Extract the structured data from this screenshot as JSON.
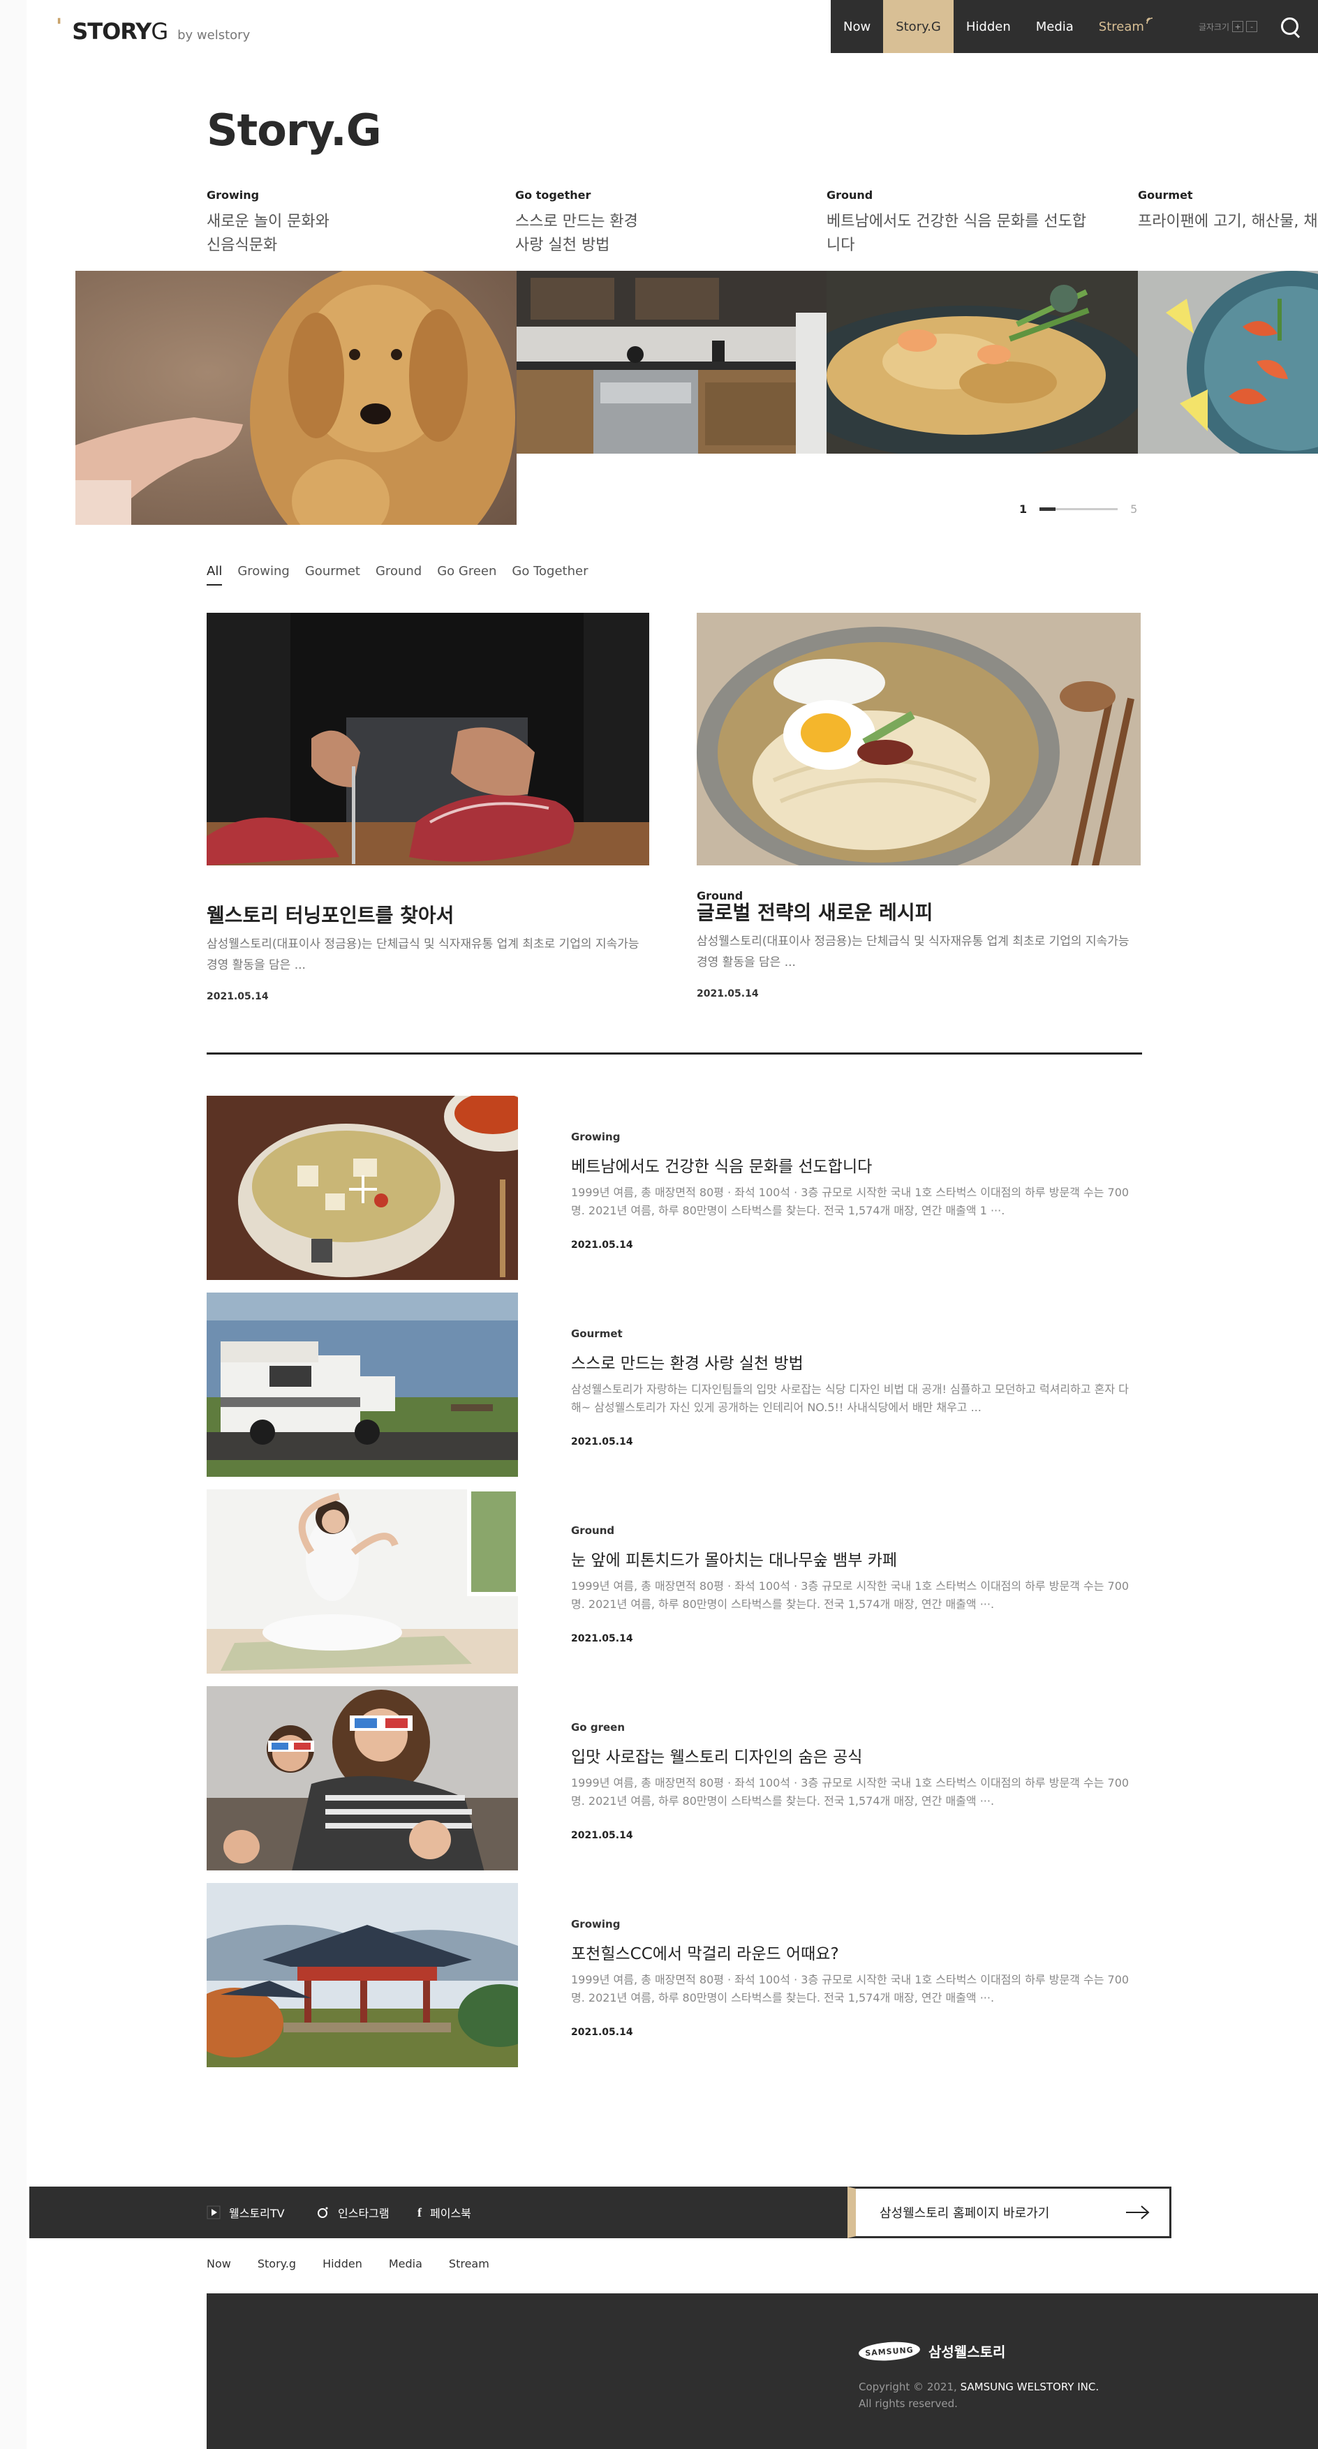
{
  "header": {
    "logo_mark": "'",
    "logo_story": "STORY",
    "logo_g": "G",
    "logo_by": "by welstory",
    "nav": [
      "Now",
      "Story.G",
      "Hidden",
      "Media",
      "Stream"
    ],
    "active_nav": "Story.G",
    "font_size_label": "글자크기",
    "font_plus": "+",
    "font_minus": "-"
  },
  "page_title": "Story.G",
  "carousel": {
    "slides": [
      {
        "category": "Growing",
        "title_line1": "새로운 놀이 문화와",
        "title_line2": "신음식문화",
        "image": "golden retriever giving paw"
      },
      {
        "category": "Go together",
        "title_line1": "스스로 만드는 환경",
        "title_line2": "사랑 실천 방법",
        "image": "modern kitchen"
      },
      {
        "category": "Ground",
        "title_line1": "베트남에서도 건강한 식음 문화를 선도합",
        "title_line2": "니다",
        "image": "pad thai plate"
      },
      {
        "category": "Gourmet",
        "title_line1": "프라이팬에 고기, 해산물, 채",
        "title_line2": "",
        "image": "shrimp seafood dish"
      }
    ],
    "pager_current": "1",
    "pager_total": "5",
    "pager_progress": 0.2
  },
  "filters": [
    "All",
    "Growing",
    "Gourmet",
    "Ground",
    "Go Green",
    "Go Together"
  ],
  "active_filter": "All",
  "featured": [
    {
      "category": "",
      "title": "웰스토리 터닝포인트를 찾아서",
      "desc": "삼성웰스토리(대표이사 정금용)는 단체급식 및 식자재유통 업계 최초로 기업의 지속가능경영 활동을 담은 ...",
      "date": "2021.05.14",
      "image": "chef cutting meat"
    },
    {
      "category": "Ground",
      "title": "글로벌 전략의 새로운 레시피",
      "desc": "삼성웰스토리(대표이사 정금용)는 단체급식 및 식자재유통 업계 최초로 기업의 지속가능경영 활동을 담은 ...",
      "date": "2021.05.14",
      "image": "cold noodles with egg"
    }
  ],
  "list": [
    {
      "category": "Growing",
      "title": "베트남에서도 건강한 식음 문화를 선도합니다",
      "desc": "1999년 여름, 총 매장면적 80평 · 좌석 100석 · 3층 규모로 시작한 국내 1호 스타벅스 이대점의 하루 방문객 수는 700명. 2021년 여름, 하루 80만명이 스타벅스를 찾는다. 전국 1,574개 매장, 연간 매출액 1 ···.",
      "date": "2021.05.14",
      "image": "soup bowl"
    },
    {
      "category": "Gourmet",
      "title": "스스로 만드는 환경 사랑 실천 방법",
      "desc": "삼성웰스토리가 자랑하는 디자인팀들의 입맛 사로잡는 식당 디자인 비법 대 공개! 심플하고 모던하고 럭셔리하고 혼자 다 해~ 삼성웰스토리가 자신 있게 공개하는 인테리어 NO.5!!  사내식당에서 배만 채우고 ...",
      "date": "2021.05.14",
      "image": "camper van by lake"
    },
    {
      "category": "Ground",
      "title": "눈 앞에 피톤치드가 몰아치는 대나무숲 뱀부 카페",
      "desc": "1999년 여름, 총 매장면적 80평 · 좌석 100석 · 3층 규모로 시작한 국내 1호 스타벅스 이대점의 하루 방문객 수는 700명. 2021년 여름, 하루 80만명이 스타벅스를 찾는다. 전국 1,574개 매장, 연간 매출액 ···.",
      "date": "2021.05.14",
      "image": "woman doing yoga"
    },
    {
      "category": "Go green",
      "title": "입맛 사로잡는 웰스토리 디자인의 숨은 공식",
      "desc": "1999년 여름, 총 매장면적 80평 · 좌석 100석 · 3층 규모로 시작한 국내 1호 스타벅스 이대점의 하루 방문객 수는 700명. 2021년 여름, 하루 80만명이 스타벅스를 찾는다. 전국 1,574개 매장, 연간 매출액 ···.",
      "date": "2021.05.14",
      "image": "family with 3d glasses"
    },
    {
      "category": "Growing",
      "title": "포천힐스CC에서 막걸리 라운드 어때요?",
      "desc": "1999년 여름, 총 매장면적 80평 · 좌석 100석 · 3층 규모로 시작한 국내 1호 스타벅스 이대점의 하루 방문객 수는 700명. 2021년 여름, 하루 80만명이 스타벅스를 찾는다. 전국 1,574개 매장, 연간 매출액 ···.",
      "date": "2021.05.14",
      "image": "korean pavilion"
    }
  ],
  "footer": {
    "social": [
      {
        "label": "웰스토리TV",
        "icon": "play-icon"
      },
      {
        "label": "인스타그램",
        "icon": "instagram-icon"
      },
      {
        "label": "페이스북",
        "icon": "facebook-icon"
      }
    ],
    "home_button": "삼성웰스토리 홈페이지 바로가기",
    "nav": [
      "Now",
      "Story.g",
      "Hidden",
      "Media",
      "Stream"
    ],
    "samsung_logo": "SAMSUNG",
    "company_name": "삼성웰스토리",
    "copyright_prefix": "Copyright © 2021,",
    "copyright_company": "SAMSUNG WELSTORY INC.",
    "rights": "All rights reserved."
  },
  "colors": {
    "accent": "#d8bf95",
    "dark": "#2f2f2f"
  }
}
